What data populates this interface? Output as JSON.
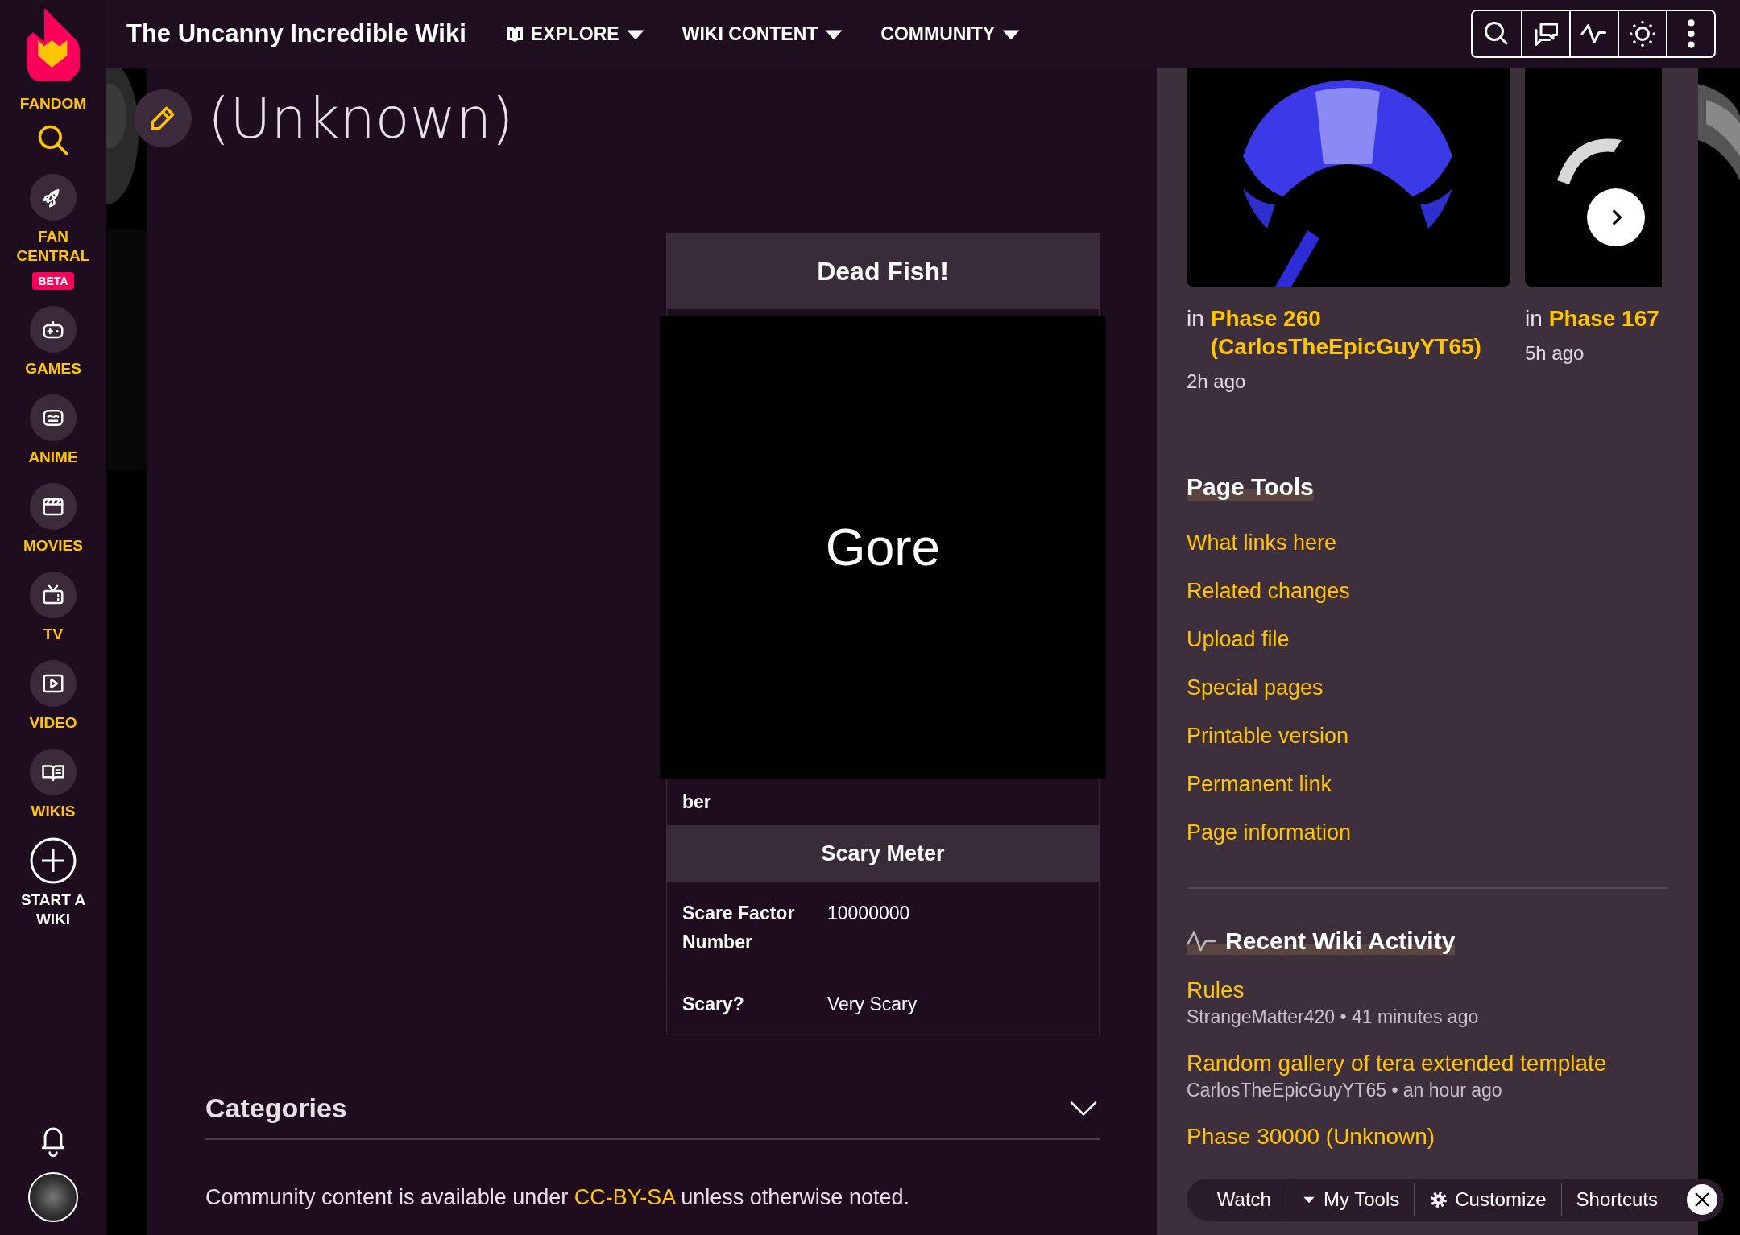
{
  "rail": {
    "brand": "FANDOM",
    "items": [
      {
        "label": "FAN CENTRAL",
        "badge": "BETA"
      },
      {
        "label": "GAMES"
      },
      {
        "label": "ANIME"
      },
      {
        "label": "MOVIES"
      },
      {
        "label": "TV"
      },
      {
        "label": "VIDEO"
      },
      {
        "label": "WIKIS"
      }
    ],
    "start_wiki": "START A WIKI"
  },
  "header": {
    "wiki_name": "The Uncanny Incredible Wiki",
    "nav": [
      {
        "label": "EXPLORE",
        "kind": "book"
      },
      {
        "label": "WIKI CONTENT",
        "kind": "plain"
      },
      {
        "label": "COMMUNITY",
        "kind": "plain"
      }
    ]
  },
  "page": {
    "title": "(Unknown)"
  },
  "infobox": {
    "title": "Dead Fish!",
    "image_overlay": "Gore",
    "cut_label": "ber",
    "section": "Scary Meter",
    "rows": [
      {
        "label": "Scare Factor Number",
        "value": "10000000"
      },
      {
        "label": "Scary?",
        "value": "Very Scary"
      }
    ]
  },
  "categories": {
    "title": "Categories"
  },
  "footer": {
    "before": "Community content is available under ",
    "link": "CC-BY-SA",
    "after": " unless otherwise noted."
  },
  "gallery": [
    {
      "prefix": "in",
      "page": "Phase 260 (CarlosTheEpicGuyYT65)",
      "time": "2h ago"
    },
    {
      "prefix": "in",
      "page": "Phase 167",
      "time": "5h ago"
    }
  ],
  "page_tools": {
    "title": "Page Tools",
    "links": [
      "What links here",
      "Related changes",
      "Upload file",
      "Special pages",
      "Printable version",
      "Permanent link",
      "Page information"
    ]
  },
  "recent_activity": {
    "title": "Recent Wiki Activity",
    "items": [
      {
        "page": "Rules",
        "meta": "StrangeMatter420 • 41 minutes ago"
      },
      {
        "page": "Random gallery of tera extended template",
        "meta": "CarlosTheEpicGuyYT65 • an hour ago"
      },
      {
        "page": "Phase 30000 (Unknown)"
      }
    ]
  },
  "toolbar": {
    "items": [
      {
        "label": "Watch",
        "kind": "plain"
      },
      {
        "label": "My Tools",
        "kind": "menu"
      },
      {
        "label": "Customize",
        "kind": "settings"
      },
      {
        "label": "Shortcuts",
        "kind": "plain"
      }
    ]
  }
}
